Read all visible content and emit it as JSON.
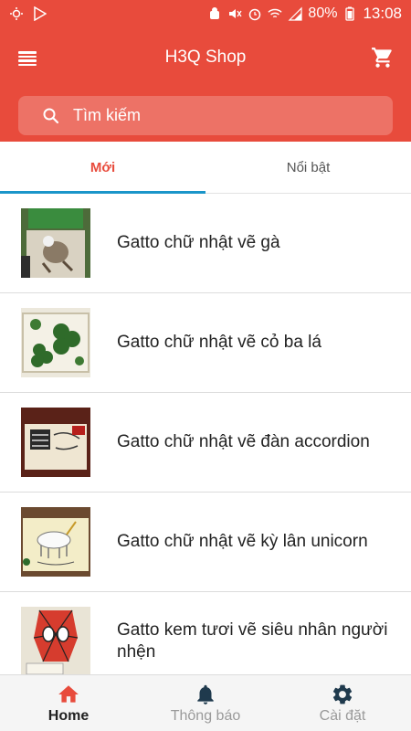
{
  "status_bar": {
    "battery": "80%",
    "time": "13:08"
  },
  "app_bar": {
    "title": "H3Q Shop"
  },
  "search": {
    "placeholder": "Tìm kiếm"
  },
  "tabs": [
    {
      "label": "Mới",
      "active": true
    },
    {
      "label": "Nổi bật",
      "active": false
    }
  ],
  "products": [
    {
      "name": "Gatto chữ nhật vẽ gà"
    },
    {
      "name": "Gatto chữ nhật vẽ cỏ ba lá"
    },
    {
      "name": "Gatto chữ nhật vẽ đàn accordion"
    },
    {
      "name": "Gatto chữ nhật vẽ kỳ lân unicorn"
    },
    {
      "name": "Gatto kem tươi vẽ siêu nhân người nhện"
    }
  ],
  "bottom_nav": [
    {
      "label": "Home",
      "icon": "home-icon",
      "active": true
    },
    {
      "label": "Thông báo",
      "icon": "bell-icon",
      "active": false
    },
    {
      "label": "Cài đặt",
      "icon": "gear-icon",
      "active": false
    }
  ],
  "colors": {
    "primary": "#e84b3c",
    "tab_indicator": "#1a95c9"
  }
}
